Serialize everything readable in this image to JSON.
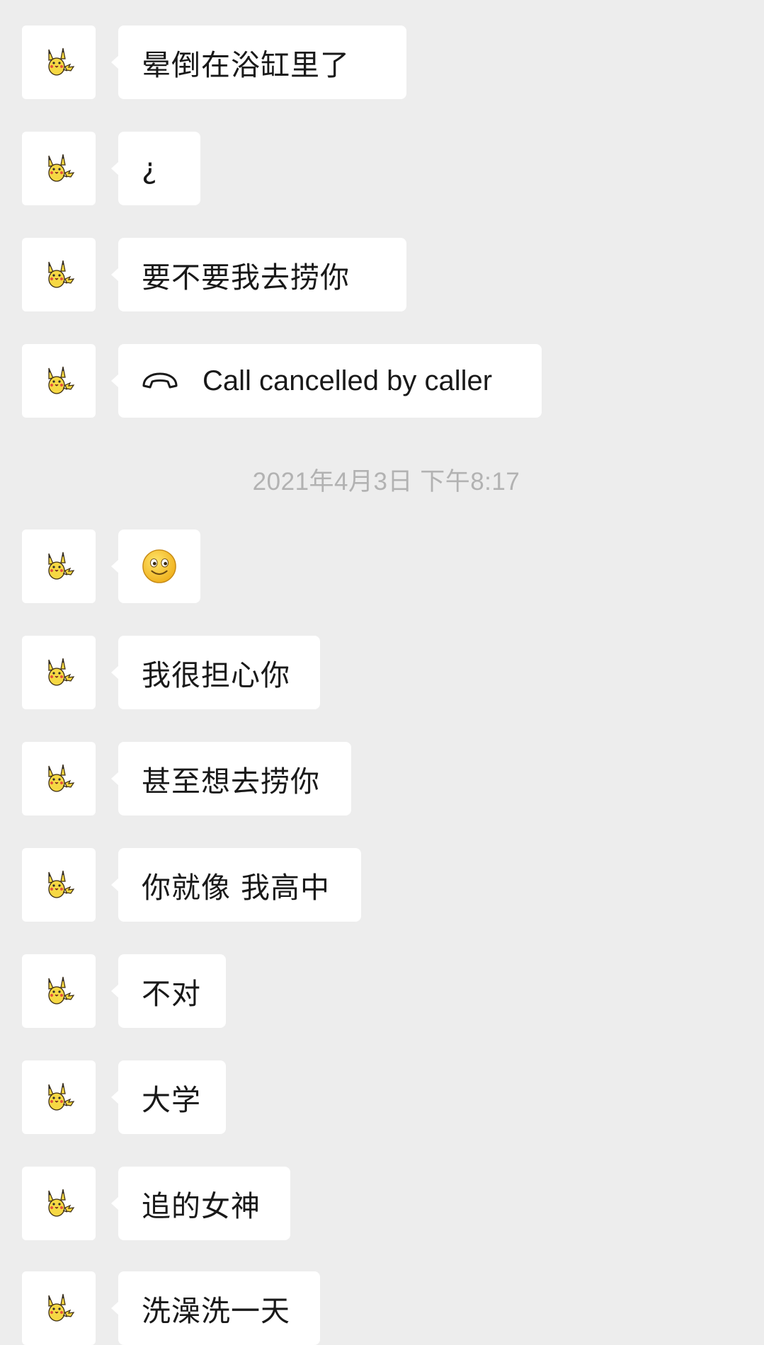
{
  "messages_before": [
    {
      "text": "晕倒在浴缸里了"
    },
    {
      "text": "¿"
    },
    {
      "text": "要不要我去捞你"
    }
  ],
  "call_message": {
    "icon": "phone-hangup-icon",
    "text": "Call cancelled by caller"
  },
  "timestamp": "2021年4月3日 下午8:17",
  "emoji_message": {
    "icon": "smile-emoji-icon"
  },
  "messages_after": [
    {
      "text": "我很担心你"
    },
    {
      "text": "甚至想去捞你"
    },
    {
      "text": "你就像 我高中"
    },
    {
      "text": "不对"
    },
    {
      "text": "大学"
    },
    {
      "text": "追的女神"
    },
    {
      "text": "洗澡洗一天"
    }
  ],
  "avatar": {
    "icon": "pikachu-avatar-icon",
    "colors": {
      "body": "#f6d844",
      "outline": "#3a2a10",
      "ear_tip": "#2b2b2b",
      "cheek": "#e5533b"
    }
  },
  "colors": {
    "background": "#ededed",
    "bubble": "#ffffff",
    "text": "#191919",
    "timestamp": "#b2b2b2"
  }
}
